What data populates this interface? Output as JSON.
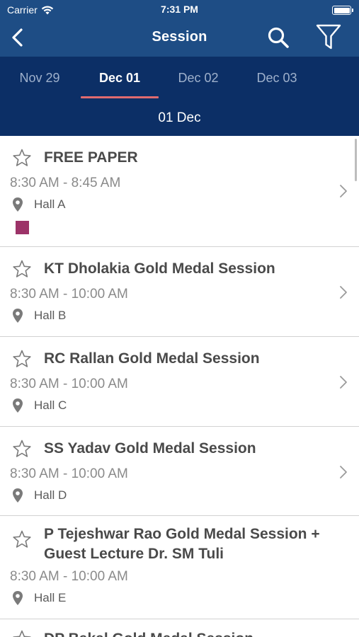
{
  "status_bar": {
    "carrier": "Carrier",
    "time": "7:31 PM"
  },
  "nav": {
    "title": "Session"
  },
  "tabs": [
    {
      "label": "Nov 29",
      "active": false
    },
    {
      "label": "Dec 01",
      "active": true
    },
    {
      "label": "Dec 02",
      "active": false
    },
    {
      "label": "Dec 03",
      "active": false
    }
  ],
  "selected_date": "01 Dec",
  "sessions": [
    {
      "title": "FREE PAPER",
      "time": "8:30 AM - 8:45 AM",
      "hall": "Hall A",
      "tag_color": "#9c3368"
    },
    {
      "title": "KT Dholakia Gold Medal Session",
      "time": "8:30 AM - 10:00 AM",
      "hall": "Hall B"
    },
    {
      "title": "RC Rallan Gold Medal Session",
      "time": "8:30 AM - 10:00 AM",
      "hall": "Hall C"
    },
    {
      "title": "SS Yadav Gold Medal Session",
      "time": "8:30 AM - 10:00 AM",
      "hall": "Hall D"
    },
    {
      "title_line1": "P Tejeshwar Rao Gold Medal Session +",
      "title_line2": "Guest Lecture Dr. SM Tuli",
      "time": "8:30 AM - 10:00 AM",
      "hall": "Hall E"
    },
    {
      "title": "DP Bakal Gold Medal Session"
    }
  ],
  "colors": {
    "nav_bar": "#1e4d85",
    "date_bar": "#0c2f66",
    "tab_indicator": "#e06b6f"
  }
}
